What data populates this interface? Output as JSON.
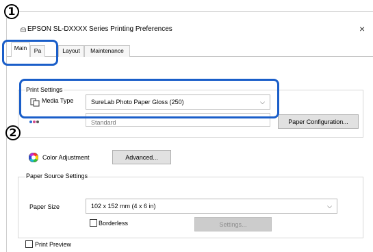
{
  "window": {
    "title": "EPSON SL-DXXXX Series Printing Preferences",
    "close_glyph": "×",
    "icon": "printer-icon"
  },
  "tabs": [
    {
      "label": "Main"
    },
    {
      "label": "Pa"
    },
    {
      "label": "Layout"
    },
    {
      "label": "Maintenance"
    }
  ],
  "print_settings": {
    "group_label": "Print Settings",
    "media_type_label": "Media Type",
    "media_type_value": "SureLab Photo Paper Gloss (250)",
    "print_quality_value": "Standard",
    "paper_config_button": "Paper Configuration..."
  },
  "color": {
    "label": "Color Adjustment",
    "advanced_button": "Advanced..."
  },
  "paper_source": {
    "group_label": "Paper Source Settings",
    "paper_size_label": "Paper Size",
    "paper_size_value": "102 x 152 mm (4 x 6 in)",
    "borderless_label": "Borderless",
    "settings_button": "Settings..."
  },
  "print_preview_label": "Print Preview",
  "callouts": {
    "one": "1",
    "two": "2",
    "color": "#1a5ec9"
  },
  "chevron_glyph": "⌵"
}
